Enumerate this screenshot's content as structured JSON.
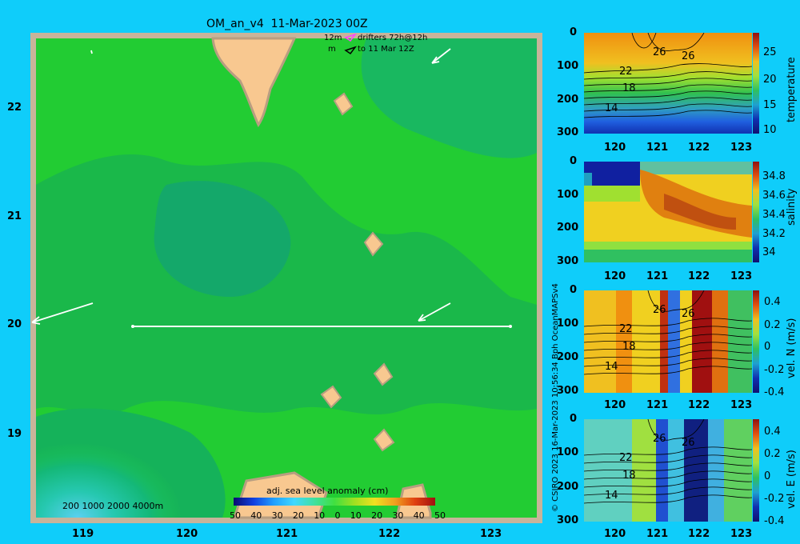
{
  "map": {
    "title": "OM_an_v4  11-Mar-2023 00Z",
    "drifters_line1": "12m",
    "drifters_line1b": "drifters 72h@12h",
    "drifters_line2": "m",
    "drifters_line2b": "to 11 Mar 12Z",
    "lat_ticks": [
      "22",
      "21",
      "20",
      "19"
    ],
    "lon_ticks": [
      "119",
      "120",
      "121",
      "122",
      "123"
    ],
    "depth_legend": "200  1000  2000  4000m",
    "colorbar_title": "adj. sea level anomaly (cm)",
    "colorbar_ticks": [
      "50",
      "40",
      "30",
      "20",
      "10",
      "0",
      "10",
      "20",
      "30",
      "40",
      "50"
    ],
    "section_lat": 20.0,
    "section_lon_range": [
      119.5,
      123.2
    ]
  },
  "credit": "© CSIRO 2023  16-Mar-2023 10:56:34 Bph OceanMAPSv4",
  "panels": [
    {
      "name": "temperature",
      "ylabel": "temperature",
      "yticks": [
        "0",
        "100",
        "200",
        "300"
      ],
      "xticks": [
        "120",
        "121",
        "122",
        "123"
      ],
      "cbar_ticks": [
        "25",
        "20",
        "15",
        "10"
      ],
      "contour_labels": [
        "26",
        "26",
        "22",
        "18",
        "14"
      ]
    },
    {
      "name": "salinity",
      "ylabel": "salinity",
      "yticks": [
        "0",
        "100",
        "200",
        "300"
      ],
      "xticks": [
        "120",
        "121",
        "122",
        "123"
      ],
      "cbar_ticks": [
        "34.8",
        "34.6",
        "34.4",
        "34.2",
        "34"
      ]
    },
    {
      "name": "vel-n",
      "ylabel": "vel. N (m/s)",
      "yticks": [
        "0",
        "100",
        "200",
        "300"
      ],
      "xticks": [
        "120",
        "121",
        "122",
        "123"
      ],
      "cbar_ticks": [
        "0.4",
        "0.2",
        "0",
        "-0.2",
        "-0.4"
      ],
      "contour_labels": [
        "26",
        "26",
        "22",
        "18",
        "14"
      ]
    },
    {
      "name": "vel-e",
      "ylabel": "vel. E (m/s)",
      "yticks": [
        "0",
        "100",
        "200",
        "300"
      ],
      "xticks": [
        "120",
        "121",
        "122",
        "123"
      ],
      "cbar_ticks": [
        "0.4",
        "0.2",
        "0",
        "-0.2",
        "-0.4"
      ],
      "contour_labels": [
        "26",
        "26",
        "22",
        "18",
        "14"
      ]
    }
  ]
}
